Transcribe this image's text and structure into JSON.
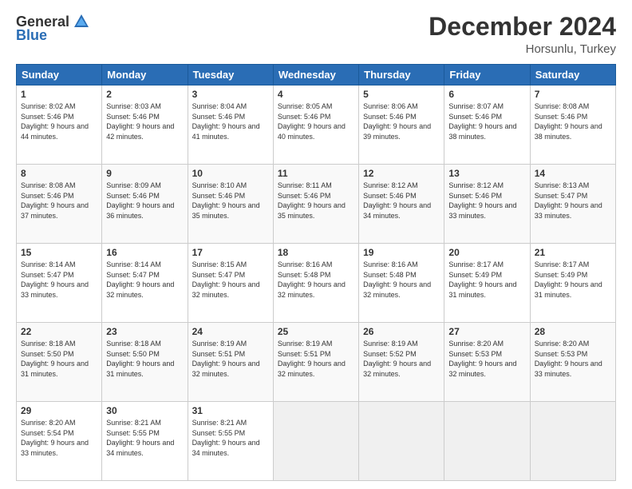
{
  "logo": {
    "general": "General",
    "blue": "Blue"
  },
  "header": {
    "month": "December 2024",
    "location": "Horsunlu, Turkey"
  },
  "days_header": [
    "Sunday",
    "Monday",
    "Tuesday",
    "Wednesday",
    "Thursday",
    "Friday",
    "Saturday"
  ],
  "weeks": [
    [
      {
        "day": "1",
        "sunrise": "8:02 AM",
        "sunset": "5:46 PM",
        "daylight": "9 hours and 44 minutes."
      },
      {
        "day": "2",
        "sunrise": "8:03 AM",
        "sunset": "5:46 PM",
        "daylight": "9 hours and 42 minutes."
      },
      {
        "day": "3",
        "sunrise": "8:04 AM",
        "sunset": "5:46 PM",
        "daylight": "9 hours and 41 minutes."
      },
      {
        "day": "4",
        "sunrise": "8:05 AM",
        "sunset": "5:46 PM",
        "daylight": "9 hours and 40 minutes."
      },
      {
        "day": "5",
        "sunrise": "8:06 AM",
        "sunset": "5:46 PM",
        "daylight": "9 hours and 39 minutes."
      },
      {
        "day": "6",
        "sunrise": "8:07 AM",
        "sunset": "5:46 PM",
        "daylight": "9 hours and 38 minutes."
      },
      {
        "day": "7",
        "sunrise": "8:08 AM",
        "sunset": "5:46 PM",
        "daylight": "9 hours and 38 minutes."
      }
    ],
    [
      {
        "day": "8",
        "sunrise": "8:08 AM",
        "sunset": "5:46 PM",
        "daylight": "9 hours and 37 minutes."
      },
      {
        "day": "9",
        "sunrise": "8:09 AM",
        "sunset": "5:46 PM",
        "daylight": "9 hours and 36 minutes."
      },
      {
        "day": "10",
        "sunrise": "8:10 AM",
        "sunset": "5:46 PM",
        "daylight": "9 hours and 35 minutes."
      },
      {
        "day": "11",
        "sunrise": "8:11 AM",
        "sunset": "5:46 PM",
        "daylight": "9 hours and 35 minutes."
      },
      {
        "day": "12",
        "sunrise": "8:12 AM",
        "sunset": "5:46 PM",
        "daylight": "9 hours and 34 minutes."
      },
      {
        "day": "13",
        "sunrise": "8:12 AM",
        "sunset": "5:46 PM",
        "daylight": "9 hours and 33 minutes."
      },
      {
        "day": "14",
        "sunrise": "8:13 AM",
        "sunset": "5:47 PM",
        "daylight": "9 hours and 33 minutes."
      }
    ],
    [
      {
        "day": "15",
        "sunrise": "8:14 AM",
        "sunset": "5:47 PM",
        "daylight": "9 hours and 33 minutes."
      },
      {
        "day": "16",
        "sunrise": "8:14 AM",
        "sunset": "5:47 PM",
        "daylight": "9 hours and 32 minutes."
      },
      {
        "day": "17",
        "sunrise": "8:15 AM",
        "sunset": "5:47 PM",
        "daylight": "9 hours and 32 minutes."
      },
      {
        "day": "18",
        "sunrise": "8:16 AM",
        "sunset": "5:48 PM",
        "daylight": "9 hours and 32 minutes."
      },
      {
        "day": "19",
        "sunrise": "8:16 AM",
        "sunset": "5:48 PM",
        "daylight": "9 hours and 32 minutes."
      },
      {
        "day": "20",
        "sunrise": "8:17 AM",
        "sunset": "5:49 PM",
        "daylight": "9 hours and 31 minutes."
      },
      {
        "day": "21",
        "sunrise": "8:17 AM",
        "sunset": "5:49 PM",
        "daylight": "9 hours and 31 minutes."
      }
    ],
    [
      {
        "day": "22",
        "sunrise": "8:18 AM",
        "sunset": "5:50 PM",
        "daylight": "9 hours and 31 minutes."
      },
      {
        "day": "23",
        "sunrise": "8:18 AM",
        "sunset": "5:50 PM",
        "daylight": "9 hours and 31 minutes."
      },
      {
        "day": "24",
        "sunrise": "8:19 AM",
        "sunset": "5:51 PM",
        "daylight": "9 hours and 32 minutes."
      },
      {
        "day": "25",
        "sunrise": "8:19 AM",
        "sunset": "5:51 PM",
        "daylight": "9 hours and 32 minutes."
      },
      {
        "day": "26",
        "sunrise": "8:19 AM",
        "sunset": "5:52 PM",
        "daylight": "9 hours and 32 minutes."
      },
      {
        "day": "27",
        "sunrise": "8:20 AM",
        "sunset": "5:53 PM",
        "daylight": "9 hours and 32 minutes."
      },
      {
        "day": "28",
        "sunrise": "8:20 AM",
        "sunset": "5:53 PM",
        "daylight": "9 hours and 33 minutes."
      }
    ],
    [
      {
        "day": "29",
        "sunrise": "8:20 AM",
        "sunset": "5:54 PM",
        "daylight": "9 hours and 33 minutes."
      },
      {
        "day": "30",
        "sunrise": "8:21 AM",
        "sunset": "5:55 PM",
        "daylight": "9 hours and 34 minutes."
      },
      {
        "day": "31",
        "sunrise": "8:21 AM",
        "sunset": "5:55 PM",
        "daylight": "9 hours and 34 minutes."
      },
      null,
      null,
      null,
      null
    ]
  ],
  "labels": {
    "sunrise": "Sunrise:",
    "sunset": "Sunset:",
    "daylight": "Daylight:"
  }
}
